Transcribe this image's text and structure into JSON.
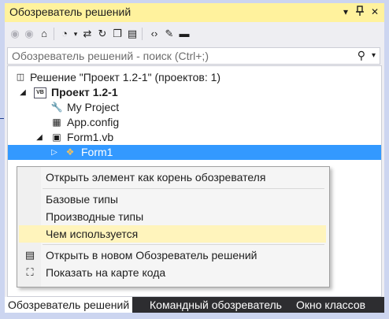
{
  "window": {
    "title": "Обозреватель решений",
    "controls": [
      "▾",
      "ᵩ",
      "✕"
    ]
  },
  "search": {
    "placeholder": "Обозреватель решений - поиск (Ctrl+;)"
  },
  "tree": {
    "solution": "Решение \"Проект 1.2-1\"  (проектов: 1)",
    "project": "Проект 1.2-1",
    "vb_badge": "VB",
    "my_project": "My Project",
    "app_config": "App.config",
    "form_vb": "Form1.vb",
    "form_class": "Form1"
  },
  "context_menu": {
    "items": [
      "Открыть элемент как корень обозревателя",
      "Базовые типы",
      "Производные типы",
      "Чем используется",
      "Открыть в новом Обозреватель решений",
      "Показать на карте кода"
    ]
  },
  "tabs": [
    "Обозреватель решений",
    "Командный обозреватель",
    "Окно классов"
  ],
  "colors": {
    "title_bar": "#fff29d",
    "selection": "#3399ff",
    "menu_highlight": "#fff4bc",
    "tab_bar": "#2d2d30"
  }
}
